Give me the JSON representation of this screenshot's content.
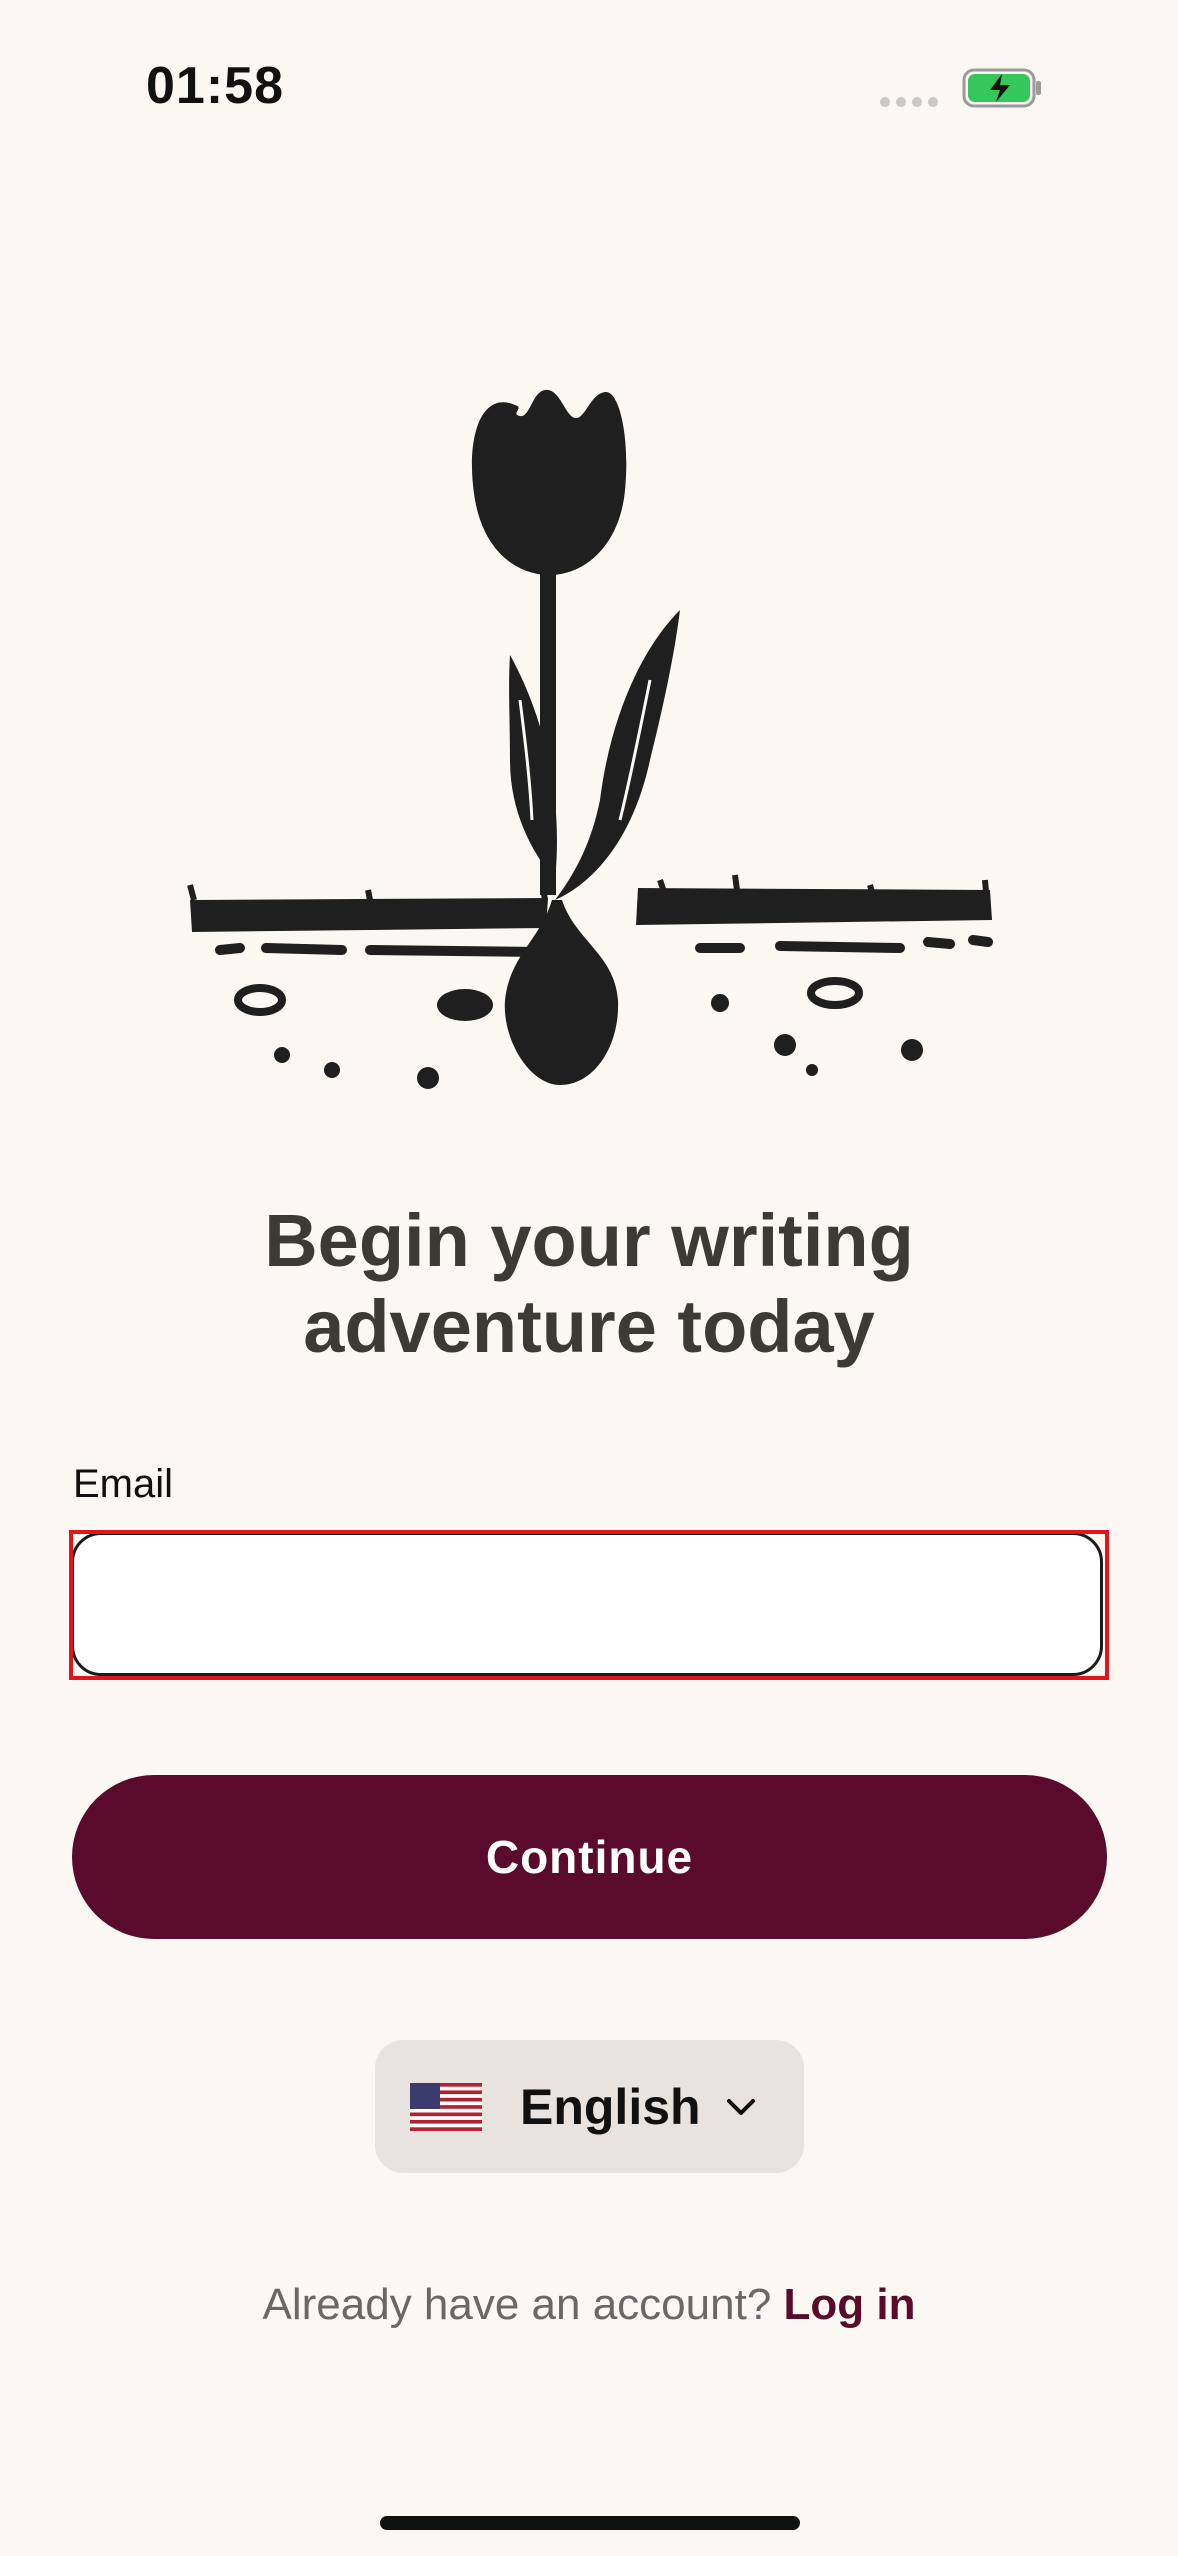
{
  "status_bar": {
    "time": "01:58",
    "battery_color": "#34c759"
  },
  "headline": {
    "line1": "Begin your writing",
    "line2": "adventure today"
  },
  "email": {
    "label": "Email",
    "value": "",
    "placeholder": ""
  },
  "continue_button": {
    "label": "Continue",
    "color": "#5a0a2b"
  },
  "language": {
    "selected": "English",
    "flag_icon": "us-flag-icon"
  },
  "login": {
    "prompt": "Already have an account?",
    "link": "Log in"
  }
}
